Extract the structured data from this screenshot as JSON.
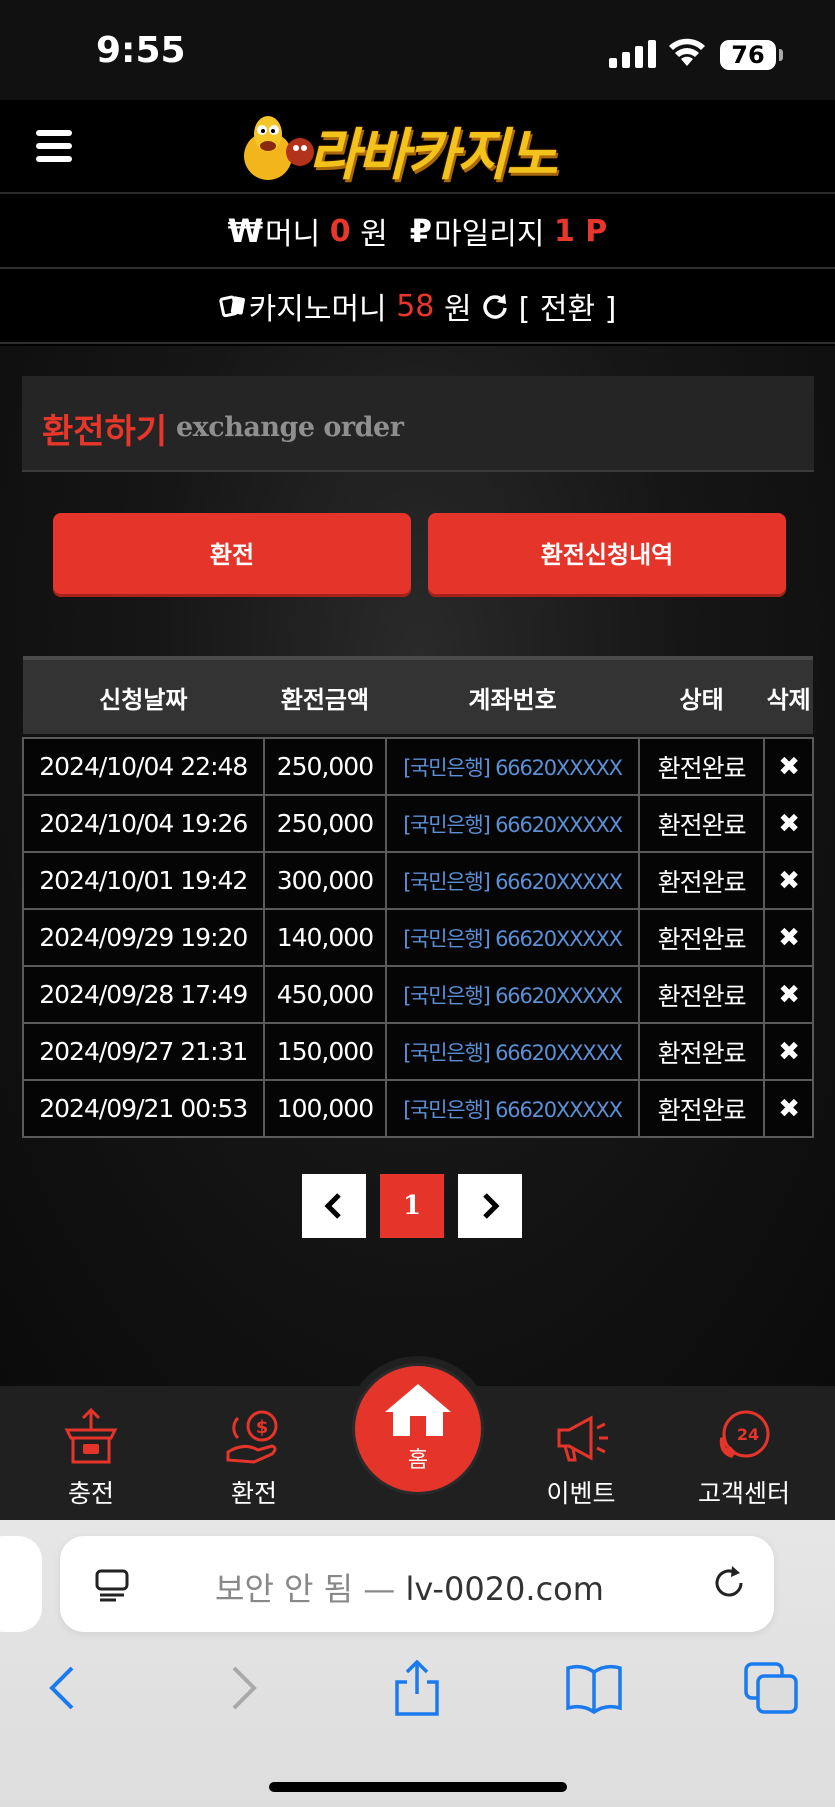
{
  "status_bar": {
    "time": "9:55",
    "battery": "76"
  },
  "header": {
    "logo_text": "라바카지노",
    "menu_icon": "hamburger-icon"
  },
  "balance": {
    "money_symbol": "₩",
    "money_label": "머니",
    "money_value": "0",
    "money_unit": "원",
    "mileage_symbol": "₽",
    "mileage_label": "마일리지",
    "mileage_value": "1 P",
    "casino_label": "카지노머니",
    "casino_value": "58",
    "casino_unit": "원",
    "convert_label": "[ 전환 ]"
  },
  "section": {
    "title_ko": "환전하기",
    "title_en": "exchange order"
  },
  "buttons": {
    "exchange": "환전",
    "history": "환전신청내역"
  },
  "table": {
    "headers": [
      "신청날짜",
      "환전금액",
      "계좌번호",
      "상태",
      "삭제"
    ],
    "rows": [
      {
        "date": "2024/10/04 22:48",
        "amount": "250,000",
        "account": "[국민은행] 66620XXXXX",
        "status": "환전완료",
        "delete": "✖"
      },
      {
        "date": "2024/10/04 19:26",
        "amount": "250,000",
        "account": "[국민은행] 66620XXXXX",
        "status": "환전완료",
        "delete": "✖"
      },
      {
        "date": "2024/10/01 19:42",
        "amount": "300,000",
        "account": "[국민은행] 66620XXXXX",
        "status": "환전완료",
        "delete": "✖"
      },
      {
        "date": "2024/09/29 19:20",
        "amount": "140,000",
        "account": "[국민은행] 66620XXXXX",
        "status": "환전완료",
        "delete": "✖"
      },
      {
        "date": "2024/09/28 17:49",
        "amount": "450,000",
        "account": "[국민은행] 66620XXXXX",
        "status": "환전완료",
        "delete": "✖"
      },
      {
        "date": "2024/09/27 21:31",
        "amount": "150,000",
        "account": "[국민은행] 66620XXXXX",
        "status": "환전완료",
        "delete": "✖"
      },
      {
        "date": "2024/09/21 00:53",
        "amount": "100,000",
        "account": "[국민은행] 66620XXXXX",
        "status": "환전완료",
        "delete": "✖"
      }
    ]
  },
  "pagination": {
    "prev": "‹",
    "current": "1",
    "next": "›"
  },
  "bottom_nav": {
    "charge": "충전",
    "exchange": "환전",
    "home": "홈",
    "event": "이벤트",
    "support": "고객센터",
    "support_badge": "24"
  },
  "browser": {
    "url_prefix": "보안 안 됨 —",
    "url_domain": "lv-0020.com"
  },
  "colors": {
    "accent": "#e5342a",
    "link": "#5b8fd6",
    "logo": "#f3c21b"
  }
}
